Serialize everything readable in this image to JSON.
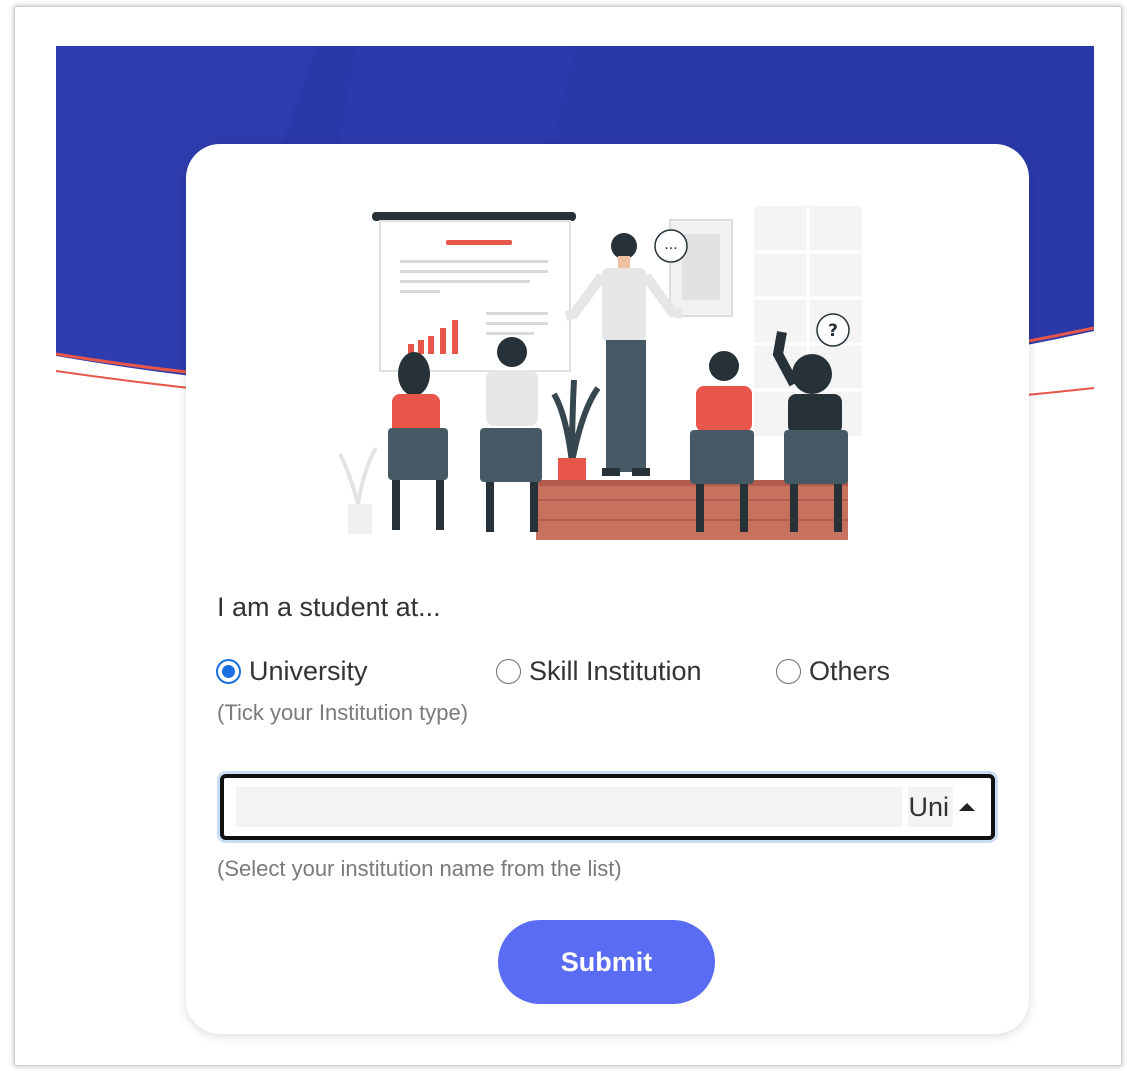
{
  "form": {
    "prompt": "I am a student at...",
    "options": [
      {
        "label": "University",
        "checked": true
      },
      {
        "label": "Skill Institution",
        "checked": false
      },
      {
        "label": "Others",
        "checked": false
      }
    ],
    "type_hint": "(Tick your Institution type)",
    "institution_select": {
      "input_value": "",
      "selected_value": "Uni"
    },
    "list_hint": "(Select your institution name from the list)",
    "submit_label": "Submit"
  },
  "illustration": {
    "question_mark": "?",
    "speech_dots": "..."
  },
  "colors": {
    "banner": "#2a39a8",
    "accent_red": "#e8564a",
    "radio_checked": "#1a6fe0",
    "submit_button": "#5b6cf4"
  }
}
